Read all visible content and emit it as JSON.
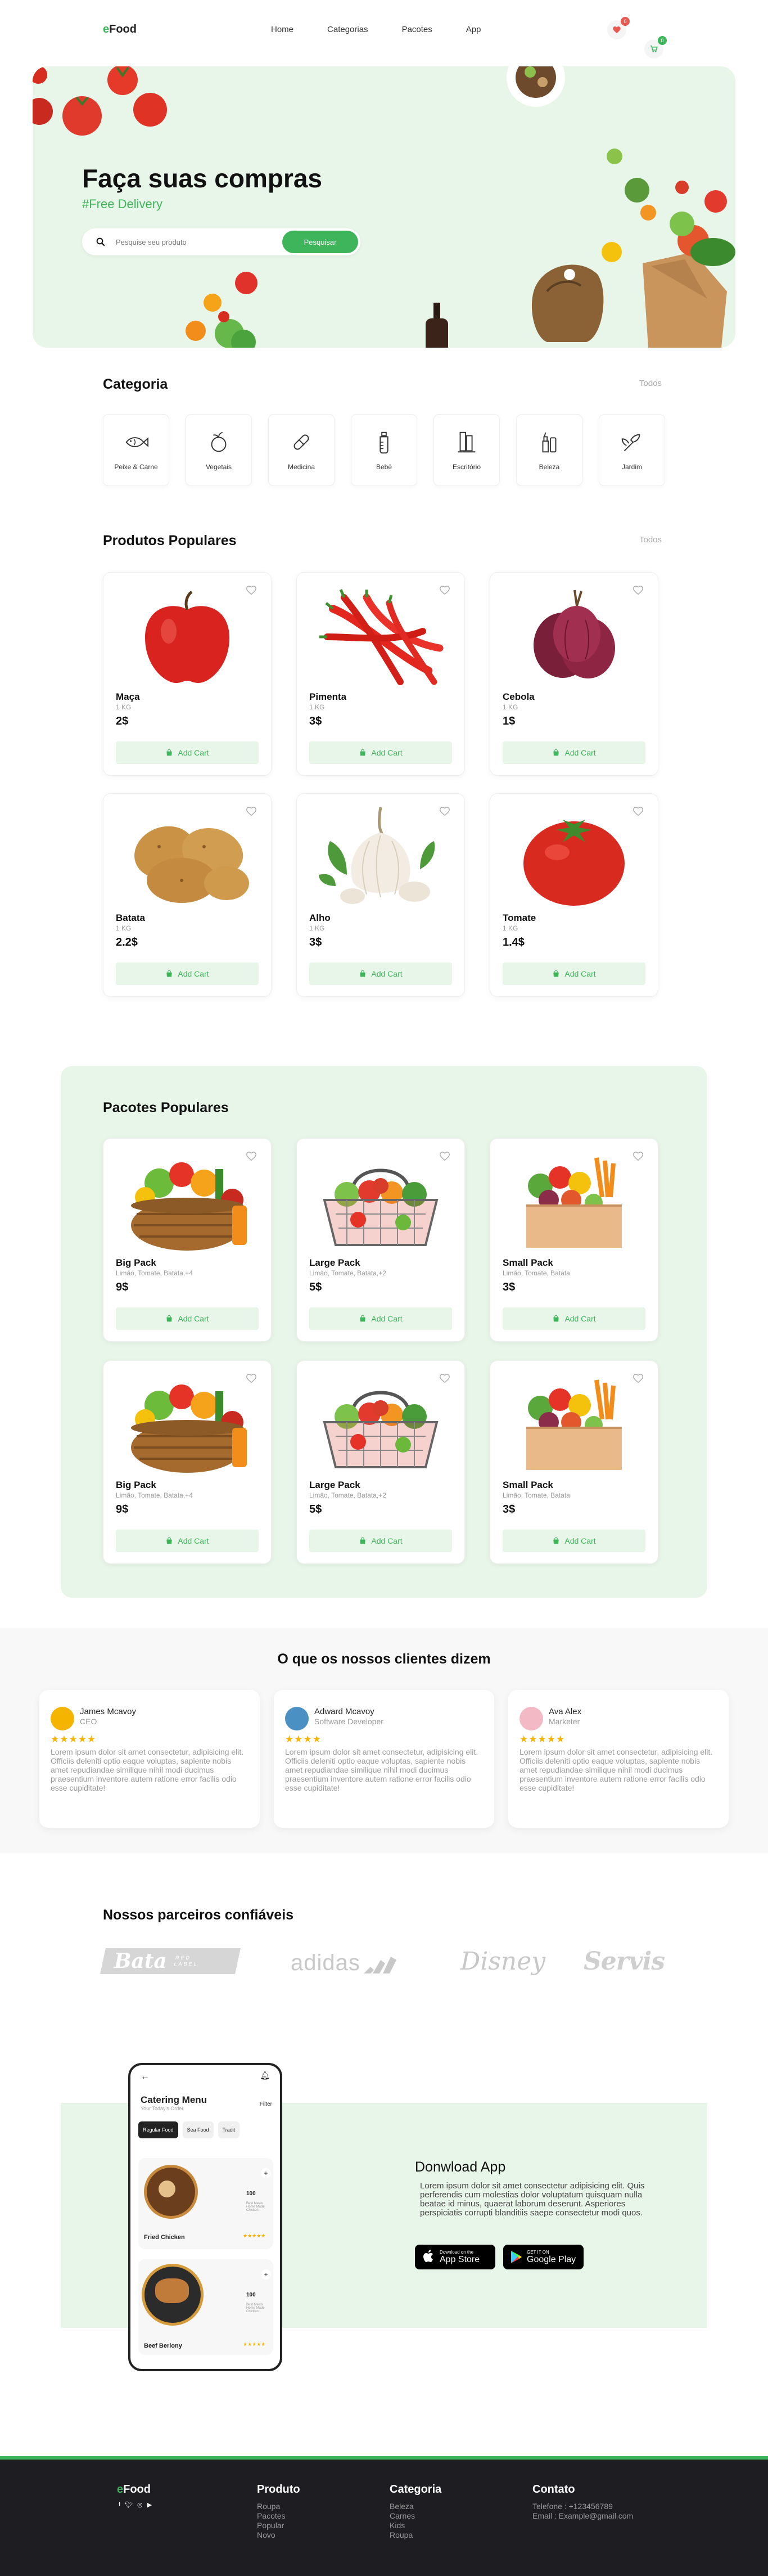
{
  "header": {
    "logo_e": "e",
    "logo_rest": "Food",
    "nav": [
      "Home",
      "Categorias",
      "Pacotes",
      "App"
    ],
    "wish_count": "0",
    "cart_count": "0"
  },
  "hero": {
    "title": "Faça suas compras",
    "subtitle": "#Free Delivery",
    "search_placeholder": "Pesquise seu produto",
    "search_button": "Pesquisar"
  },
  "categories": {
    "title": "Categoria",
    "see_all": "Todos",
    "items": [
      {
        "label": "Peixe & Carne",
        "icon": "fish-icon"
      },
      {
        "label": "Vegetais",
        "icon": "vegetable-icon"
      },
      {
        "label": "Medicina",
        "icon": "pill-icon"
      },
      {
        "label": "Bebê",
        "icon": "baby-bottle-icon"
      },
      {
        "label": "Escritório",
        "icon": "office-icon"
      },
      {
        "label": "Beleza",
        "icon": "beauty-icon"
      },
      {
        "label": "Jardim",
        "icon": "garden-icon"
      }
    ]
  },
  "popular": {
    "title": "Produtos Populares",
    "see_all": "Todos",
    "add_label": "Add Cart",
    "items": [
      {
        "name": "Maça",
        "unit": "1 KG",
        "price": "2$",
        "image": "apple"
      },
      {
        "name": "Pimenta",
        "unit": "1 KG",
        "price": "3$",
        "image": "pepper"
      },
      {
        "name": "Cebola",
        "unit": "1 KG",
        "price": "1$",
        "image": "onion"
      },
      {
        "name": "Batata",
        "unit": "1 KG",
        "price": "2.2$",
        "image": "potato"
      },
      {
        "name": "Alho",
        "unit": "1 KG",
        "price": "3$",
        "image": "garlic"
      },
      {
        "name": "Tomate",
        "unit": "1 KG",
        "price": "1.4$",
        "image": "tomato"
      }
    ]
  },
  "packs": {
    "title": "Pacotes Populares",
    "add_label": "Add Cart",
    "items": [
      {
        "name": "Big Pack",
        "desc": "Limão, Tomate, Batata,+4",
        "price": "9$",
        "image": "basket"
      },
      {
        "name": "Large Pack",
        "desc": "Limão, Tomate, Batata,+2",
        "price": "5$",
        "image": "metal-basket"
      },
      {
        "name": "Small Pack",
        "desc": "Limão, Tomate, Batata",
        "price": "3$",
        "image": "box"
      },
      {
        "name": "Big Pack",
        "desc": "Limão, Tomate, Batata,+4",
        "price": "9$",
        "image": "basket"
      },
      {
        "name": "Large Pack",
        "desc": "Limão, Tomate, Batata,+2",
        "price": "5$",
        "image": "metal-basket"
      },
      {
        "name": "Small Pack",
        "desc": "Limão, Tomate, Batata",
        "price": "3$",
        "image": "box"
      }
    ]
  },
  "testimonials": {
    "title": "O que os nossos clientes dizem",
    "items": [
      {
        "name": "James Mcavoy",
        "role": "CEO",
        "stars": "★★★★★",
        "text": "Lorem ipsum dolor sit amet consectetur, adipisicing elit. Officiis deleniti optio eaque voluptas, sapiente nobis amet repudiandae similique nihil modi ducimus praesentium inventore autem ratione error facilis odio esse cupiditate!",
        "color": "#f5b400"
      },
      {
        "name": "Adward Mcavoy",
        "role": "Software Developer",
        "stars": "★★★★",
        "text": "Lorem ipsum dolor sit amet consectetur, adipisicing elit. Officiis deleniti optio eaque voluptas, sapiente nobis amet repudiandae similique nihil modi ducimus praesentium inventore autem ratione error facilis odio esse cupiditate!",
        "color": "#4a90c2"
      },
      {
        "name": "Ava Alex",
        "role": "Marketer",
        "stars": "★★★★★",
        "text": "Lorem ipsum dolor sit amet consectetur, adipisicing elit. Officiis deleniti optio eaque voluptas, sapiente nobis amet repudiandae similique nihil modi ducimus praesentium inventore autem ratione error facilis odio esse cupiditate!",
        "color": "#f3b9c5"
      }
    ]
  },
  "partners": {
    "title": "Nossos parceiros confiáveis",
    "logos": [
      "Bata",
      "RED LABEL",
      "adidas",
      "Disney",
      "Servis"
    ]
  },
  "app": {
    "title": "Donwload App",
    "text": "Lorem ipsum dolor sit amet consectetur adipisicing elit. Quis perferendis cum molestias dolor voluptatum quisquam nulla beatae id minus, quaerat laborum deserunt. Asperiores perspiciatis corrupti blanditiis saepe consectetur modi quos.",
    "appstore_small": "Download on the",
    "appstore_big": "App Store",
    "gplay_small": "GET IT ON",
    "gplay_big": "Google Play",
    "phone": {
      "title": "Catering Menu",
      "subtitle": "Your Today's Order",
      "filter": "Filter",
      "tabs": [
        "Regular Food",
        "Sea Food",
        "Tradit"
      ],
      "items": [
        {
          "name": "Fried Chicken",
          "price": "100"
        },
        {
          "name": "Beef Berlony",
          "price": "100"
        }
      ],
      "stars": "★★★★★",
      "note": "Best Meals Home Made Chicken"
    }
  },
  "footer": {
    "logo_e": "e",
    "logo_rest": "Food",
    "social": [
      "facebook-icon",
      "twitter-icon",
      "instagram-icon",
      "youtube-icon"
    ],
    "cols": [
      {
        "title": "Produto",
        "links": [
          "Roupa",
          "Pacotes",
          "Popular",
          "Novo"
        ]
      },
      {
        "title": "Categoria",
        "links": [
          "Beleza",
          "Carnes",
          "Kids",
          "Roupa"
        ]
      },
      {
        "title": "Contato",
        "links": [
          "Telefone : +123456789",
          "Email : Example@gmail.com"
        ]
      }
    ]
  },
  "colors": {
    "accent": "#3fb55b",
    "light_green": "#e8f5e9",
    "badge_red": "#e85a4f",
    "footer_bg": "#1d1d22"
  }
}
